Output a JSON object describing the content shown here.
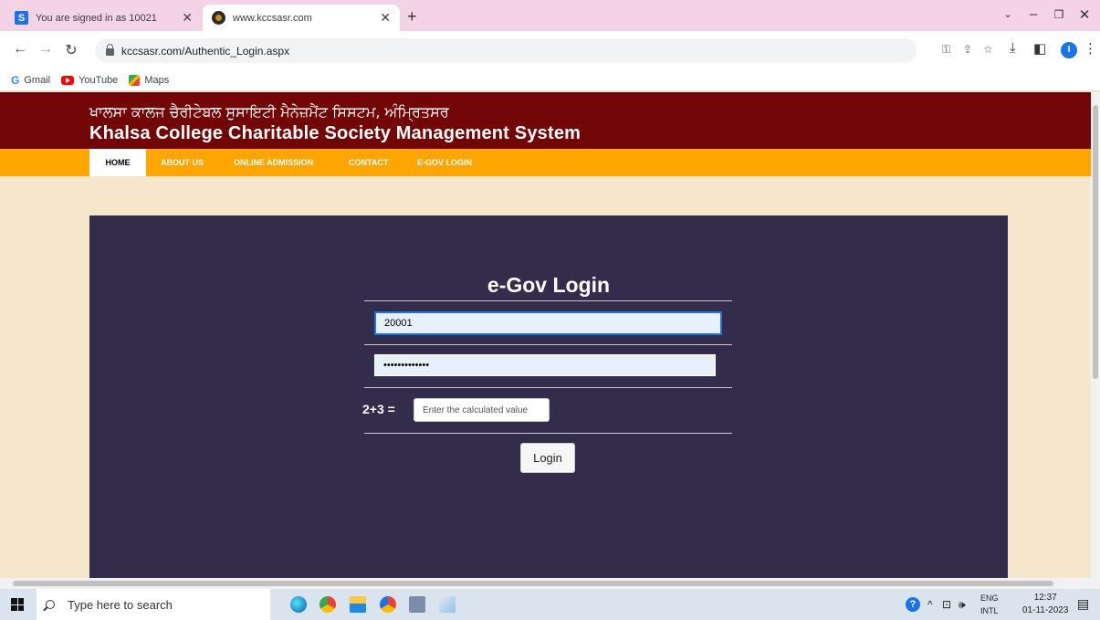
{
  "browser": {
    "tabs": [
      {
        "title": "You are signed in as 10021",
        "favicon": "S",
        "active": false
      },
      {
        "title": "www.kccsasr.com",
        "active": true
      }
    ],
    "url": "kccsasr.com/Authentic_Login.aspx",
    "bookmarks": [
      {
        "label": "Gmail",
        "icon": "G"
      },
      {
        "label": "YouTube",
        "icon": "youtube-icon"
      },
      {
        "label": "Maps",
        "icon": "maps-icon"
      }
    ],
    "profile_initial": "I"
  },
  "site": {
    "title_punjabi": "ਖਾਲਸਾ ਕਾਲਜ ਚੈਰੀਟੇਬਲ ਸੁਸਾਇਟੀ ਮੈਨੇਜ਼ਮੈਂਟ ਸਿਸਟਮ, ਅੰਮ੍ਰਿਤਸਰ",
    "title_english": "Khalsa College Charitable Society Management System",
    "header_color": "#720505",
    "nav_color": "#ffa500",
    "nav": [
      {
        "label": "HOME",
        "current": true
      },
      {
        "label": "ABOUT US"
      },
      {
        "label": "ONLINE ADMISSION"
      },
      {
        "label": "CONTACT"
      },
      {
        "label": "E-GOV LOGIN"
      }
    ]
  },
  "login": {
    "title": "e-Gov Login",
    "username_value": "20001",
    "password_value": "•••••••••••••",
    "captcha_question": "2+3 =",
    "captcha_placeholder": "Enter the calculated value",
    "login_label": "Login",
    "panel_color": "#332c4b"
  },
  "taskbar": {
    "search_placeholder": "Type here to search",
    "lang_top": "ENG",
    "lang_bottom": "INTL",
    "time": "12:37",
    "date": "01-11-2023"
  }
}
